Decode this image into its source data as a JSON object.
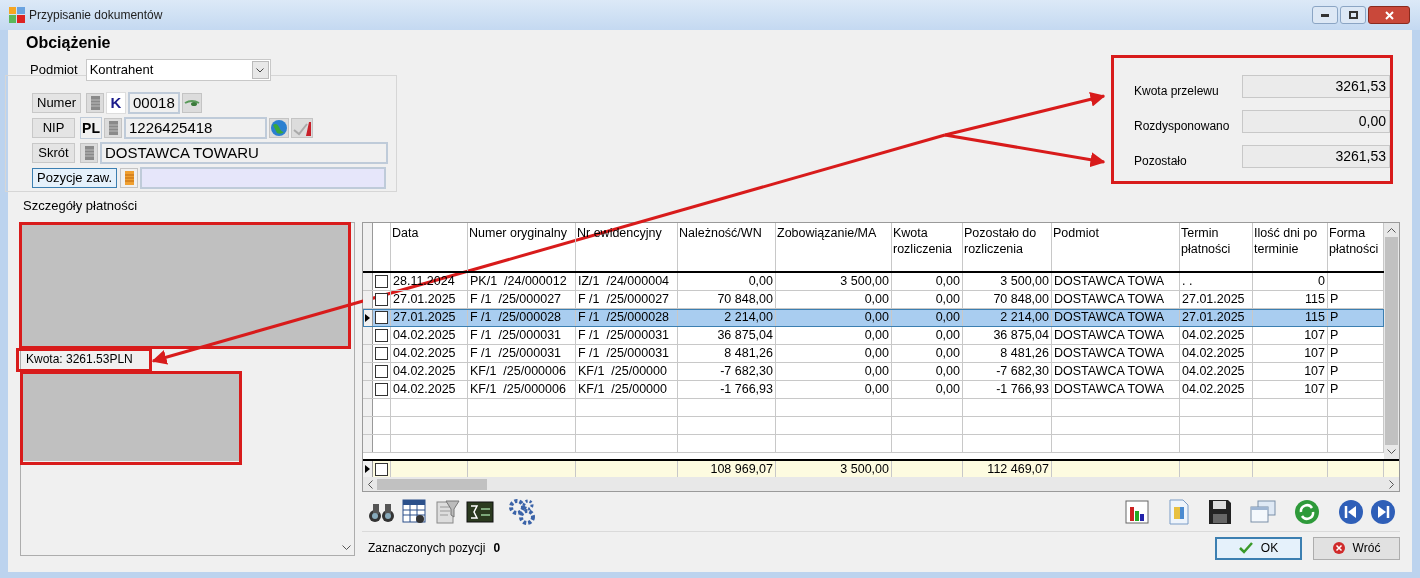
{
  "window": {
    "title": "Przypisanie dokumentów"
  },
  "heading": "Obciążenie",
  "podmiot": {
    "label": "Podmiot",
    "value": "Kontrahent"
  },
  "contractor": {
    "numer": {
      "button": "Numer",
      "prefix": "K",
      "value": "00018"
    },
    "nip": {
      "button": "NIP",
      "prefix": "PL",
      "value": "1226425418"
    },
    "skrot": {
      "button": "Skrót",
      "value": "DOSTAWCA TOWARU"
    },
    "pozycje": {
      "button": "Pozycje zaw."
    }
  },
  "summary": [
    {
      "label": "Kwota przelewu",
      "value": "3261,53"
    },
    {
      "label": "Rozdysponowano",
      "value": "0,00"
    },
    {
      "label": "Pozostało",
      "value": "3261,53"
    }
  ],
  "details": {
    "title": "Szczegóły płatności",
    "amount": "Kwota: 3261.53PLN"
  },
  "table": {
    "columns": [
      {
        "label": "Data"
      },
      {
        "label": "Numer oryginalny"
      },
      {
        "label": "Nr ewidencyjny"
      },
      {
        "label": "Należność/WN",
        "total": "108 969,07"
      },
      {
        "label": "Zobowiązanie/MA",
        "total": "3 500,00"
      },
      {
        "label": "Kwota rozliczenia"
      },
      {
        "label": "Pozostało do rozliczenia",
        "total": "112 469,07"
      },
      {
        "label": "Podmiot"
      },
      {
        "label": "Termin płatności"
      },
      {
        "label": "Ilość dni po terminie"
      },
      {
        "label": "Forma płatności"
      }
    ],
    "rows": [
      {
        "selected": false,
        "checked": false,
        "cells": [
          "28.11.2024",
          "PK/1  /24/000012",
          "IZ/1  /24/000004",
          "0,00",
          "3 500,00",
          "0,00",
          "3 500,00",
          "DOSTAWCA TOWA",
          ". .",
          "0"
        ]
      },
      {
        "selected": false,
        "checked": false,
        "cells": [
          "27.01.2025",
          "F /1  /25/000027",
          "F /1  /25/000027",
          "70 848,00",
          "0,00",
          "0,00",
          "70 848,00",
          "DOSTAWCA TOWA",
          "27.01.2025",
          "115",
          "P"
        ]
      },
      {
        "selected": true,
        "checked": false,
        "cells": [
          "27.01.2025",
          "F /1  /25/000028",
          "F /1  /25/000028",
          "2 214,00",
          "0,00",
          "0,00",
          "2 214,00",
          "DOSTAWCA TOWA",
          "27.01.2025",
          "115",
          "P"
        ]
      },
      {
        "selected": false,
        "checked": false,
        "cells": [
          "04.02.2025",
          "F /1  /25/000031",
          "F /1  /25/000031",
          "36 875,04",
          "0,00",
          "0,00",
          "36 875,04",
          "DOSTAWCA TOWA",
          "04.02.2025",
          "107",
          "P"
        ]
      },
      {
        "selected": false,
        "checked": false,
        "cells": [
          "04.02.2025",
          "F /1  /25/000031",
          "F /1  /25/000031",
          "8 481,26",
          "0,00",
          "0,00",
          "8 481,26",
          "DOSTAWCA TOWA",
          "04.02.2025",
          "107",
          "P"
        ]
      },
      {
        "selected": false,
        "checked": false,
        "cells": [
          "04.02.2025",
          "KF/1  /25/000006",
          "KF/1  /25/00000",
          "-7 682,30",
          "0,00",
          "0,00",
          "-7 682,30",
          "DOSTAWCA TOWA",
          "04.02.2025",
          "107",
          "P"
        ]
      },
      {
        "selected": false,
        "checked": false,
        "cells": [
          "04.02.2025",
          "KF/1  /25/000006",
          "KF/1  /25/00000",
          "-1 766,93",
          "0,00",
          "0,00",
          "-1 766,93",
          "DOSTAWCA TOWA",
          "04.02.2025",
          "107",
          "P"
        ]
      }
    ],
    "totals_checked": false
  },
  "status": {
    "label": "Zaznaczonych pozycji",
    "count": "0"
  },
  "buttons": [
    {
      "kind": "ok",
      "label": "OK"
    },
    {
      "kind": "back",
      "label": "Wróć"
    }
  ]
}
